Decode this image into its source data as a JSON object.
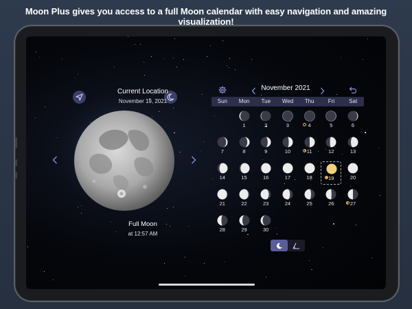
{
  "headline": "Moon Plus gives you access to a full Moon calendar with easy navigation and amazing visualization!",
  "location": {
    "title": "Current Location",
    "date": "November 19, 2021"
  },
  "phase": {
    "name": "Full Moon",
    "time": "at 12:57 AM"
  },
  "icons": {
    "location": "location-arrow-icon",
    "night_mode": "crescent-moon-icon",
    "settings": "gear-icon",
    "back": "undo-arrow-icon",
    "prev_moon": "chevron-left-icon",
    "next_moon": "chevron-right-icon"
  },
  "calendar": {
    "month": "November 2021",
    "prev_label": "‹",
    "next_label": "›",
    "weekdays": [
      "Sun",
      "Mon",
      "Tue",
      "Wed",
      "Thu",
      "Fri",
      "Sat"
    ],
    "first_weekday_index": 1,
    "selected_day": 19,
    "days": [
      {
        "day": "1",
        "illum": 0.1,
        "waxing": false
      },
      {
        "day": "2",
        "illum": 0.05,
        "waxing": false
      },
      {
        "day": "3",
        "illum": 0.01,
        "waxing": false
      },
      {
        "day": "4",
        "illum": 0.0,
        "waxing": true,
        "marker": "new"
      },
      {
        "day": "5",
        "illum": 0.02,
        "waxing": true
      },
      {
        "day": "6",
        "illum": 0.07,
        "waxing": true
      },
      {
        "day": "7",
        "illum": 0.14,
        "waxing": true
      },
      {
        "day": "8",
        "illum": 0.22,
        "waxing": true
      },
      {
        "day": "9",
        "illum": 0.31,
        "waxing": true
      },
      {
        "day": "10",
        "illum": 0.4,
        "waxing": true
      },
      {
        "day": "11",
        "illum": 0.5,
        "waxing": true,
        "marker": "quarter"
      },
      {
        "day": "12",
        "illum": 0.6,
        "waxing": true
      },
      {
        "day": "13",
        "illum": 0.7,
        "waxing": true
      },
      {
        "day": "14",
        "illum": 0.8,
        "waxing": true
      },
      {
        "day": "15",
        "illum": 0.88,
        "waxing": true
      },
      {
        "day": "16",
        "illum": 0.94,
        "waxing": true
      },
      {
        "day": "17",
        "illum": 0.98,
        "waxing": true
      },
      {
        "day": "18",
        "illum": 1.0,
        "waxing": true
      },
      {
        "day": "19",
        "illum": 1.0,
        "waxing": true,
        "marker": "full"
      },
      {
        "day": "20",
        "illum": 0.98,
        "waxing": false
      },
      {
        "day": "21",
        "illum": 0.94,
        "waxing": false
      },
      {
        "day": "22",
        "illum": 0.88,
        "waxing": false
      },
      {
        "day": "23",
        "illum": 0.8,
        "waxing": false
      },
      {
        "day": "24",
        "illum": 0.72,
        "waxing": false
      },
      {
        "day": "25",
        "illum": 0.63,
        "waxing": false
      },
      {
        "day": "26",
        "illum": 0.55,
        "waxing": false
      },
      {
        "day": "27",
        "illum": 0.5,
        "waxing": false,
        "marker": "quarter"
      },
      {
        "day": "28",
        "illum": 0.4,
        "waxing": false
      },
      {
        "day": "29",
        "illum": 0.3,
        "waxing": false
      },
      {
        "day": "30",
        "illum": 0.2,
        "waxing": false
      }
    ]
  },
  "view_toggle": {
    "options": [
      "moon-view-icon",
      "sun-angle-icon"
    ],
    "selected": 0
  },
  "colors": {
    "accent": "#8b92e6",
    "marker": "#e6b15a",
    "selected_full_moon": "#f3d27c",
    "weekday_bar": "#2c2e4a"
  }
}
